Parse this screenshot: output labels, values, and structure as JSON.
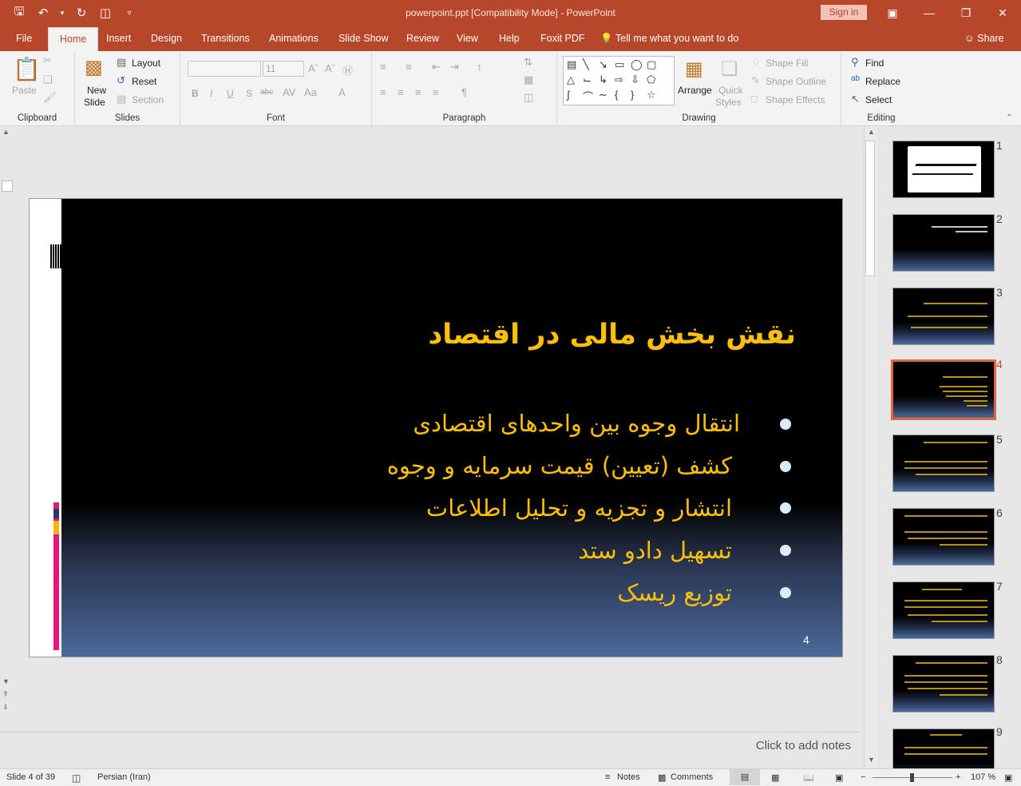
{
  "app": {
    "title": "powerpoint.ppt [Compatibility Mode]  -  PowerPoint",
    "sign_in": "Sign in"
  },
  "tabs": [
    "File",
    "Home",
    "Insert",
    "Design",
    "Transitions",
    "Animations",
    "Slide Show",
    "Review",
    "View",
    "Help",
    "Foxit PDF"
  ],
  "active_tab": "Home",
  "tell_me": "Tell me what you want to do",
  "share": "Share",
  "ribbon": {
    "clipboard": {
      "paste": "Paste",
      "label": "Clipboard"
    },
    "slides": {
      "new_slide_1": "New",
      "new_slide_2": "Slide",
      "layout": "Layout",
      "reset": "Reset",
      "section": "Section",
      "label": "Slides"
    },
    "font": {
      "size": "11",
      "bold": "B",
      "italic": "I",
      "underline": "U",
      "shadow": "S",
      "strike": "abc",
      "label": "Font"
    },
    "paragraph": {
      "label": "Paragraph"
    },
    "drawing": {
      "arrange": "Arrange",
      "quick_1": "Quick",
      "quick_2": "Styles",
      "fill": "Shape Fill",
      "outline": "Shape Outline",
      "effects": "Shape Effects",
      "label": "Drawing"
    },
    "editing": {
      "find": "Find",
      "replace": "Replace",
      "select": "Select",
      "label": "Editing"
    }
  },
  "slide": {
    "title": "نقش بخش مالی در اقتصاد",
    "bullets": [
      "انتقال وجوه بین واحدهای اقتصادی",
      "کشف (تعیین) قیمت سرمایه و وجوه",
      "انتشار و تجزیه و تحلیل اطلاعات",
      "تسهیل دادو ستد",
      "توزیع ریسک"
    ],
    "number": "4"
  },
  "notes_placeholder": "Click to add notes",
  "thumbnails": [
    "1",
    "2",
    "3",
    "4",
    "5",
    "6",
    "7",
    "8",
    "9"
  ],
  "selected_thumbnail": 4,
  "status": {
    "slide_info": "Slide 4 of 39",
    "language": "Persian (Iran)",
    "notes": "Notes",
    "comments": "Comments",
    "zoom": "107 %"
  },
  "colors": {
    "accent": "#b7472a",
    "slide_text": "#ffc000",
    "selection": "#e0663f"
  }
}
